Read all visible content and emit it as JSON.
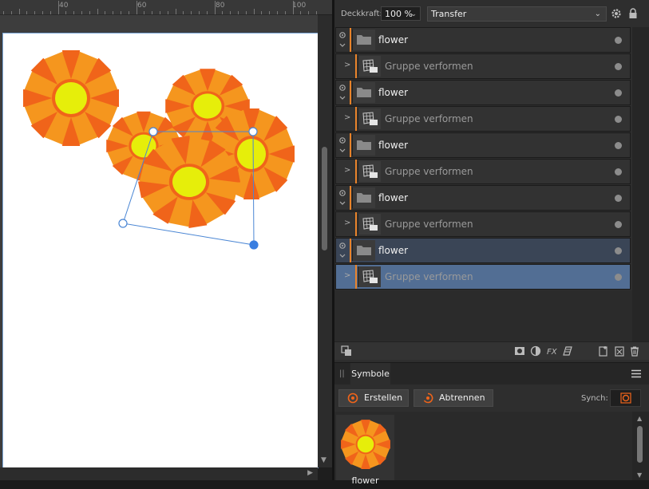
{
  "ruler": {
    "ticks": [
      "40",
      "60",
      "80",
      "100"
    ]
  },
  "toolbar": {
    "opacity_label": "Deckkraft:",
    "opacity_value": "100 %",
    "blend_mode": "Transfer"
  },
  "layers": [
    {
      "name": "flower",
      "type": "group",
      "selected": false
    },
    {
      "name": "Gruppe verformen",
      "type": "warp-group",
      "selected": false
    },
    {
      "name": "flower",
      "type": "group",
      "selected": false
    },
    {
      "name": "Gruppe verformen",
      "type": "warp-group",
      "selected": false
    },
    {
      "name": "flower",
      "type": "group",
      "selected": false
    },
    {
      "name": "Gruppe verformen",
      "type": "warp-group",
      "selected": false
    },
    {
      "name": "flower",
      "type": "group",
      "selected": false
    },
    {
      "name": "Gruppe verformen",
      "type": "warp-group",
      "selected": false
    },
    {
      "name": "flower",
      "type": "group",
      "selected": true
    },
    {
      "name": "Gruppe verformen",
      "type": "warp-group",
      "selected": true
    }
  ],
  "symbols": {
    "tab_label": "Symbole",
    "create_label": "Erstellen",
    "detach_label": "Abtrennen",
    "synch_label": "Synch:",
    "items": [
      {
        "name": "flower"
      }
    ]
  },
  "colors": {
    "petal_dark": "#f0641a",
    "petal_light": "#f5961e",
    "center": "#e6ee0a",
    "accent": "#e8832a",
    "selection": "#4a86d4"
  }
}
